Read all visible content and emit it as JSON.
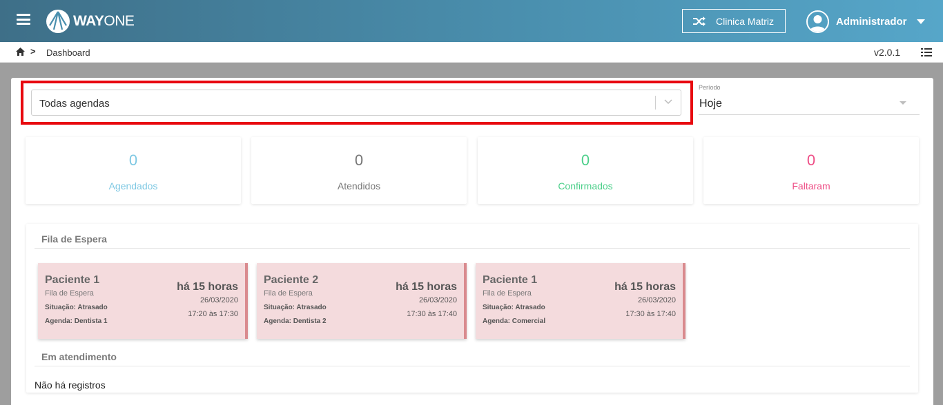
{
  "header": {
    "logo": {
      "bold": "WAY",
      "thin": "ONE"
    },
    "clinic_button": "Clinica Matriz",
    "user_name": "Administrador"
  },
  "breadcrumb": {
    "current": "Dashboard",
    "separator": ">",
    "version": "v2.0.1"
  },
  "filters": {
    "agenda_select": "Todas agendas",
    "periodo_label": "Período",
    "periodo_value": "Hoje"
  },
  "stats": [
    {
      "value": "0",
      "label": "Agendados",
      "color": "#7ec8e3"
    },
    {
      "value": "0",
      "label": "Atendidos",
      "color": "#777777"
    },
    {
      "value": "0",
      "label": "Confirmados",
      "color": "#4ccf8a"
    },
    {
      "value": "0",
      "label": "Faltaram",
      "color": "#ee4e86"
    }
  ],
  "queue": {
    "title": "Fila de Espera",
    "cards": [
      {
        "name": "Paciente 1",
        "status": "Fila de Espera",
        "situacao": "Situação: Atrasado",
        "agenda": "Agenda: Dentista 1",
        "ago": "há 15 horas",
        "date": "26/03/2020",
        "time": "17:20 às 17:30"
      },
      {
        "name": "Paciente 2",
        "status": "Fila de Espera",
        "situacao": "Situação: Atrasado",
        "agenda": "Agenda: Dentista 2",
        "ago": "há 15 horas",
        "date": "26/03/2020",
        "time": "17:30 às 17:40"
      },
      {
        "name": "Paciente 1",
        "status": "Fila de Espera",
        "situacao": "Situação: Atrasado",
        "agenda": "Agenda: Comercial",
        "ago": "há 15 horas",
        "date": "26/03/2020",
        "time": "17:30 às 17:40"
      }
    ]
  },
  "in_service": {
    "title": "Em atendimento",
    "empty": "Não há registros"
  }
}
